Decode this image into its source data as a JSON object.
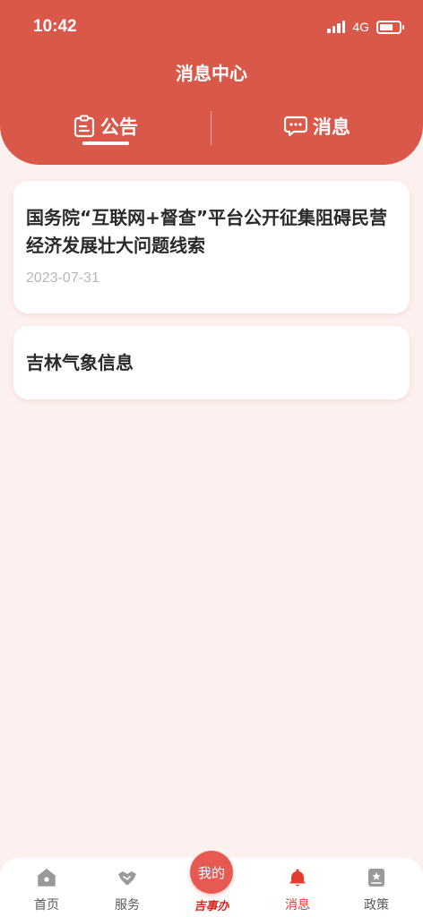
{
  "status_bar": {
    "time": "10:42",
    "network": "4G"
  },
  "header": {
    "title": "消息中心"
  },
  "tabs": [
    {
      "label": "公告",
      "icon": "notice-board-icon",
      "active": true
    },
    {
      "label": "消息",
      "icon": "chat-bubble-icon",
      "active": false
    }
  ],
  "notices": [
    {
      "title": "国务院“互联网+督查”平台公开征集阻碍民营经济发展壮大问题线索",
      "date": "2023-07-31"
    },
    {
      "title": "吉林气象信息"
    }
  ],
  "bottom_nav": {
    "items": [
      {
        "label": "首页",
        "icon": "home-icon"
      },
      {
        "label": "服务",
        "icon": "handshake-icon"
      },
      {
        "label": "消息",
        "icon": "bell-icon",
        "active": true
      },
      {
        "label": "政策",
        "icon": "policy-icon"
      }
    ],
    "center": {
      "label": "我的",
      "caption": "吉事办"
    }
  },
  "colors": {
    "brand": "#d9584a",
    "active": "#e23c30",
    "background": "#fdf1ef"
  }
}
